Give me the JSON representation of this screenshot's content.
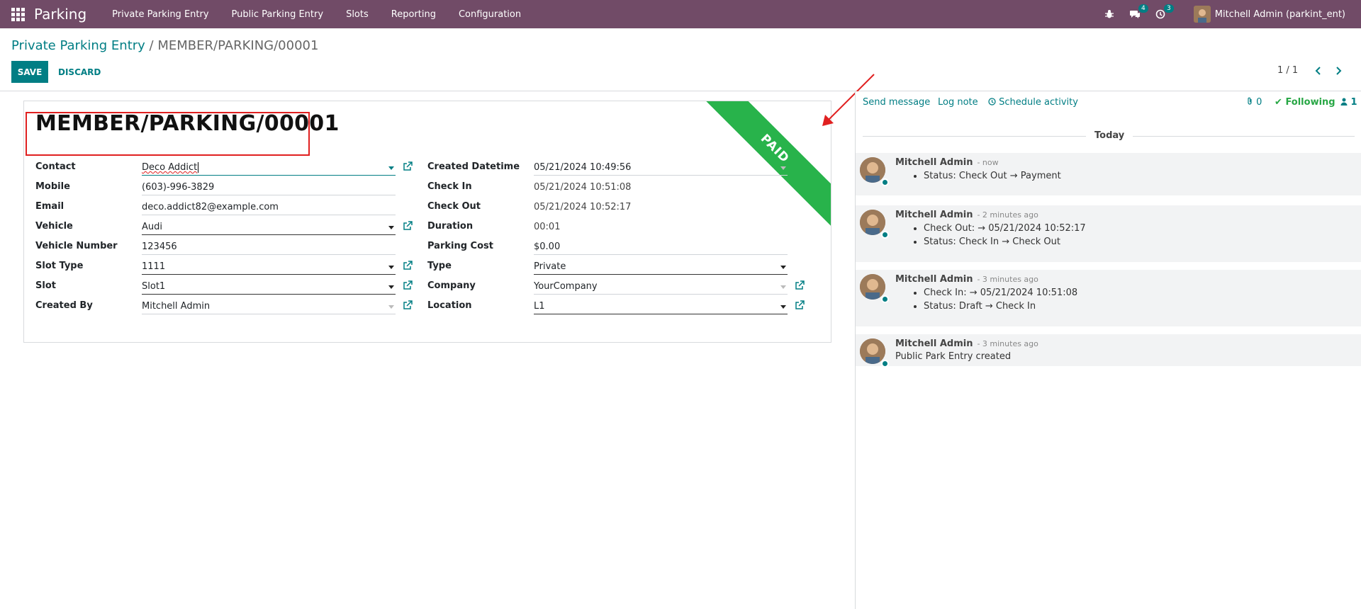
{
  "app": {
    "brand": "Parking",
    "menu": [
      "Private Parking Entry",
      "Public Parking Entry",
      "Slots",
      "Reporting",
      "Configuration"
    ],
    "messages_count": "4",
    "activities_count": "3",
    "user": "Mitchell Admin (parkint_ent)"
  },
  "breadcrumb": {
    "parent": "Private Parking Entry",
    "separator": " / ",
    "current": "MEMBER/PARKING/00001"
  },
  "toolbar": {
    "save_label": "SAVE",
    "discard_label": "DISCARD",
    "pager": "1 / 1"
  },
  "record": {
    "title": "MEMBER/PARKING/00001",
    "ribbon": "PAID",
    "left_fields": [
      {
        "label": "Contact",
        "value": "Deco Addict"
      },
      {
        "label": "Mobile",
        "value": "(603)-996-3829"
      },
      {
        "label": "Email",
        "value": "deco.addict82@example.com"
      },
      {
        "label": "Vehicle",
        "value": "Audi"
      },
      {
        "label": "Vehicle Number",
        "value": "123456"
      },
      {
        "label": "Slot Type",
        "value": "1111"
      },
      {
        "label": "Slot",
        "value": "Slot1"
      },
      {
        "label": "Created By",
        "value": "Mitchell Admin"
      }
    ],
    "right_fields": [
      {
        "label": "Created Datetime",
        "value": "05/21/2024 10:49:56"
      },
      {
        "label": "Check In",
        "value": "05/21/2024 10:51:08"
      },
      {
        "label": "Check Out",
        "value": "05/21/2024 10:52:17"
      },
      {
        "label": "Duration",
        "value": "00:01"
      },
      {
        "label": "Parking Cost",
        "value": "$0.00"
      },
      {
        "label": "Type",
        "value": "Private"
      },
      {
        "label": "Company",
        "value": "YourCompany"
      },
      {
        "label": "Location",
        "value": "L1"
      }
    ]
  },
  "chatter": {
    "send_message": "Send message",
    "log_note": "Log note",
    "schedule_activity": "Schedule activity",
    "attachments": "0",
    "following": "Following",
    "followers": "1",
    "today": "Today",
    "messages": [
      {
        "author": "Mitchell Admin",
        "time": "- now",
        "lines": [
          "Status: Check Out → Payment"
        ]
      },
      {
        "author": "Mitchell Admin",
        "time": "- 2 minutes ago",
        "lines": [
          "Check Out: → 05/21/2024 10:52:17",
          "Status: Check In → Check Out"
        ]
      },
      {
        "author": "Mitchell Admin",
        "time": "- 3 minutes ago",
        "lines": [
          "Check In: → 05/21/2024 10:51:08",
          "Status: Draft → Check In"
        ]
      },
      {
        "author": "Mitchell Admin",
        "time": "- 3 minutes ago",
        "body": "Public Park Entry created"
      }
    ]
  },
  "colors": {
    "navbar": "#714b67",
    "primary": "#017e84",
    "ribbon": "#28b34b",
    "highlight": "#e02020"
  }
}
